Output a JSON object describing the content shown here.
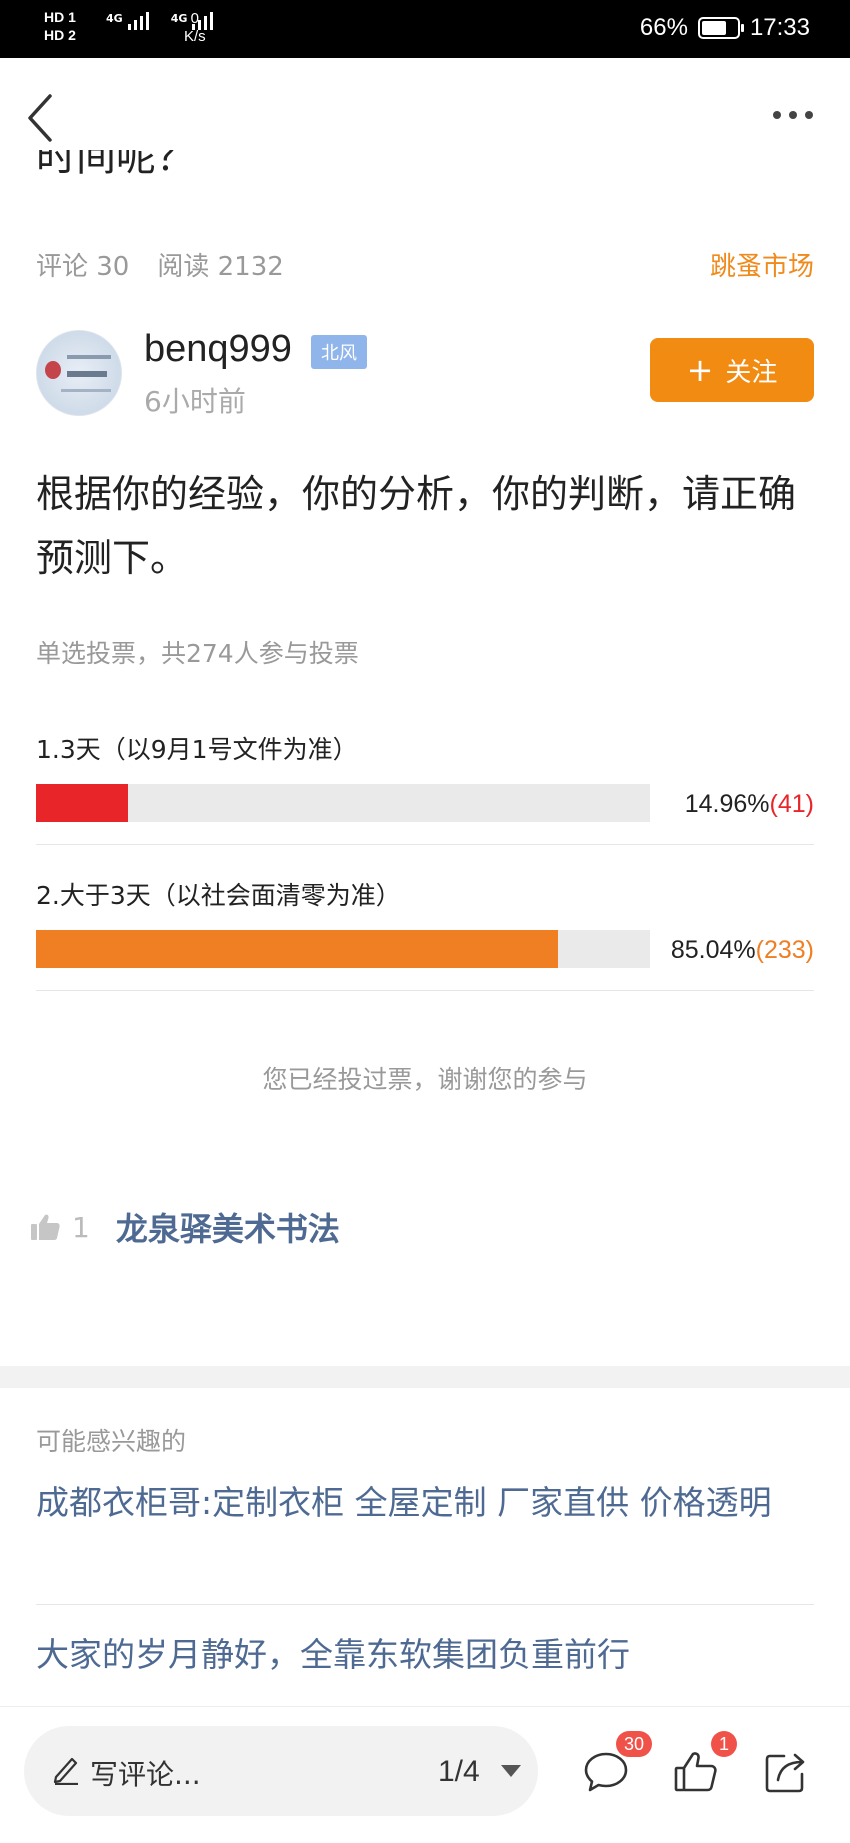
{
  "status_bar": {
    "hd1": "HD 1",
    "hd2": "HD 2",
    "net1": "4G",
    "net2": "4G",
    "speed_value": "0",
    "speed_unit": "K/s",
    "battery": "66%",
    "time": "17:33"
  },
  "post": {
    "title_fragment": "时间呢？",
    "comments_label": "评论 30",
    "reads_label": "阅读 2132",
    "market": "跳蚤市场",
    "author": {
      "name": "benq999",
      "badge": "北风",
      "time_ago": "6小时前",
      "follow_label": "关注"
    },
    "body": "根据你的经验，你的分析，你的判断，请正确预测下。"
  },
  "poll": {
    "info": "单选投票，共274人参与投票",
    "options": [
      {
        "label": "1.3天（以9月1号文件为准）",
        "percent_text": "14.96%",
        "count_text": "(41)",
        "fraction": 0.1496,
        "color": "#e8262a"
      },
      {
        "label": "2.大于3天（以社会面清零为准）",
        "percent_text": "85.04%",
        "count_text": "(233)",
        "fraction": 0.8504,
        "color": "#f07e22"
      }
    ],
    "voted_note": "您已经投过票，谢谢您的参与"
  },
  "likes": {
    "count": "1",
    "user": "龙泉驿美术书法"
  },
  "recommend": {
    "heading": "可能感兴趣的",
    "items": [
      "成都衣柜哥:定制衣柜 全屋定制 厂家直供 价格透明",
      "大家的岁月静好，全靠东软集团负重前行"
    ]
  },
  "bottom_bar": {
    "comment_placeholder": "写评论...",
    "page_indicator": "1/4",
    "comment_count": "30",
    "like_count": "1"
  },
  "colors": {
    "accent_orange": "#f28b12",
    "link_blue": "#4e6a93",
    "count_red": "#e8262a",
    "count_orange": "#f07e22"
  },
  "icons": [
    "back-icon",
    "more-icon",
    "thumb-up-icon",
    "pen-icon",
    "caret-down-icon",
    "comment-icon",
    "like-icon",
    "share-icon"
  ]
}
